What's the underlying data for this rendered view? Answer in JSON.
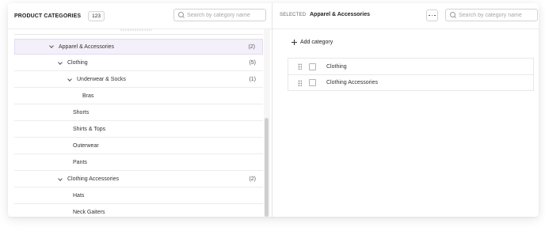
{
  "left": {
    "title": "PRODUCT CATEGORIES",
    "count": "123",
    "search_placeholder": "Search by category name"
  },
  "tree": [
    {
      "label": "Apparel & Accessories",
      "count": "(2)",
      "expanded": true,
      "selected": true
    },
    {
      "label": "Clothing",
      "count": "(5)",
      "expanded": true
    },
    {
      "label": "Underwear & Socks",
      "count": "(1)",
      "expanded": true
    },
    {
      "label": "Bras"
    },
    {
      "label": "Shorts"
    },
    {
      "label": "Shirts & Tops"
    },
    {
      "label": "Outerwear"
    },
    {
      "label": "Pants"
    },
    {
      "label": "Clothing Accessories",
      "count": "(2)",
      "expanded": true
    },
    {
      "label": "Hats"
    },
    {
      "label": "Neck Gaiters"
    }
  ],
  "right": {
    "selected_label": "SELECTED",
    "selected_value": "Apparel & Accessories",
    "search_placeholder": "Search by category name",
    "add_label": "Add category",
    "items": [
      {
        "label": "Clothing"
      },
      {
        "label": "Clothing Accessories"
      }
    ]
  },
  "icons": {
    "search": "search-icon",
    "more": "more-horizontal-icon",
    "chevron": "chevron-down-icon",
    "plus": "plus-icon",
    "drag": "drag-handle-icon"
  },
  "colors": {
    "selected_row_bg": "#f4f0fa",
    "selected_row_border": "#e4dbf1",
    "divider": "#ececec",
    "scroll_thumb": "#cfcfcf"
  }
}
